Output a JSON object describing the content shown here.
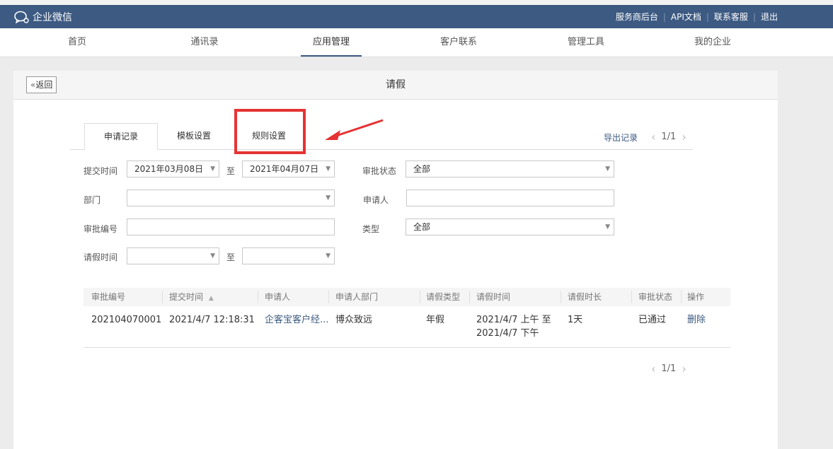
{
  "header": {
    "logo_text": "企业微信",
    "links": [
      "服务商后台",
      "API文档",
      "联系客服",
      "退出"
    ],
    "bg_color": "#3c5a82"
  },
  "nav": {
    "items": [
      "首页",
      "通讯录",
      "应用管理",
      "客户联系",
      "管理工具",
      "我的企业"
    ],
    "active": "应用管理"
  },
  "page": {
    "back_label": "返回",
    "title": "请假"
  },
  "tabs": [
    "申请记录",
    "模板设置",
    "规则设置"
  ],
  "active_tab": "申请记录",
  "export_label": "导出记录",
  "pagination": {
    "left_icon": "chevron-left-icon",
    "text": "1/1",
    "right_icon": "chevron-right-icon"
  },
  "filters": {
    "submit_time_label": "提交时间",
    "submit_time_from": "2021年03月08日",
    "to_label": "至",
    "submit_time_to": "2021年04月07日",
    "approval_status_label": "审批状态",
    "approval_status_value": "全部",
    "department_label": "部门",
    "department_value": "",
    "applicant_label": "申请人",
    "applicant_value": "",
    "approval_no_label": "审批编号",
    "approval_no_value": "",
    "type_label": "类型",
    "type_value": "全部",
    "leave_time_label": "请假时间",
    "leave_time_from": "",
    "leave_time_to": ""
  },
  "table": {
    "headers": [
      "审批编号",
      "提交时间",
      "申请人",
      "申请人部门",
      "请假类型",
      "请假时间",
      "请假时长",
      "审批状态",
      "操作"
    ],
    "sort_icon": "sort-icon",
    "rows": [
      {
        "approval_no": "202104070001",
        "submit_time": "2021/4/7 12:18:31",
        "applicant": "企客宝客户经...",
        "department": "博众致远",
        "leave_type": "年假",
        "leave_time_line1": "2021/4/7 上午 至",
        "leave_time_line2": "2021/4/7 下午",
        "duration": "1天",
        "status": "已通过",
        "action": "删除"
      }
    ]
  },
  "annotation_color": "#e53333"
}
